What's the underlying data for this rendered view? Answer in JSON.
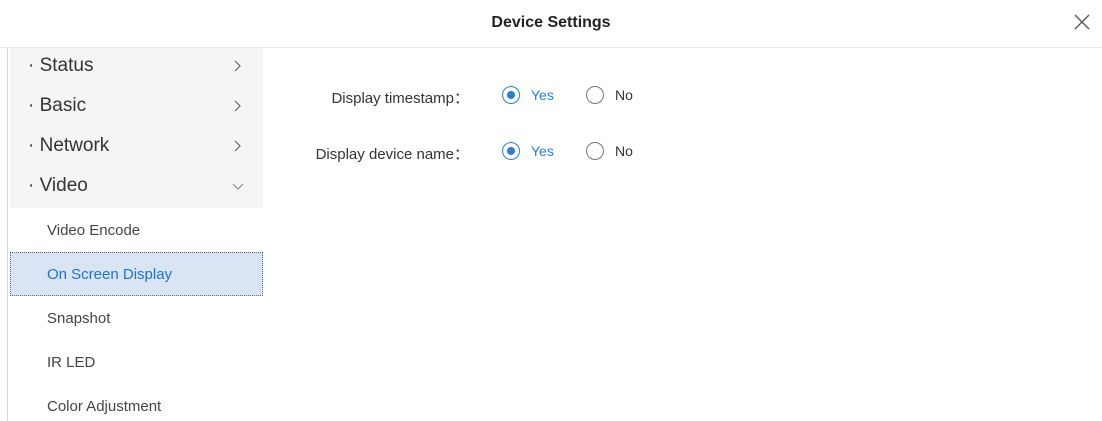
{
  "dialog": {
    "title": "Device Settings",
    "close_icon": "close-icon"
  },
  "sidebar": {
    "groups": [
      {
        "label": "· Status",
        "chevron": "chevron-right-icon",
        "expanded": false
      },
      {
        "label": "· Basic",
        "chevron": "chevron-right-icon",
        "expanded": false
      },
      {
        "label": "· Network",
        "chevron": "chevron-right-icon",
        "expanded": false
      },
      {
        "label": "· Video",
        "chevron": "chevron-down-icon",
        "expanded": true
      }
    ],
    "video_items": [
      {
        "label": "Video Encode",
        "active": false
      },
      {
        "label": "On Screen Display",
        "active": true
      },
      {
        "label": "Snapshot",
        "active": false
      },
      {
        "label": "IR LED",
        "active": false
      },
      {
        "label": "Color Adjustment",
        "active": false
      }
    ]
  },
  "osd": {
    "timestamp": {
      "label": "Display timestamp：",
      "yes_label": "Yes",
      "no_label": "No",
      "selected": "Yes"
    },
    "device_name": {
      "label": "Display device name：",
      "yes_label": "Yes",
      "no_label": "No",
      "selected": "Yes"
    }
  },
  "colors": {
    "accent": "#2a7fd4",
    "active_item_bg": "#d9e4f5",
    "group_bg": "#f5f5f5"
  }
}
